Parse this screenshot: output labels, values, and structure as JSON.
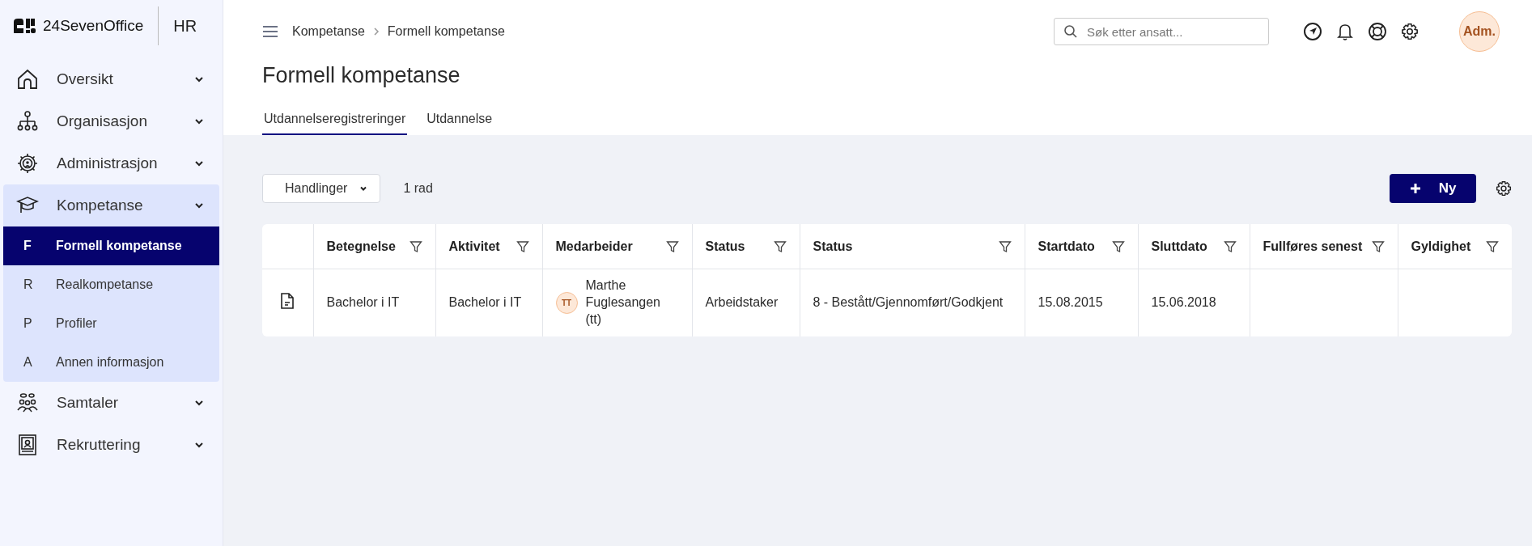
{
  "brand": {
    "name": "24SevenOffice",
    "module": "HR"
  },
  "sidebar": {
    "items": [
      {
        "label": "Oversikt",
        "expanded": false
      },
      {
        "label": "Organisasjon",
        "expanded": false
      },
      {
        "label": "Administrasjon",
        "expanded": false
      },
      {
        "label": "Kompetanse",
        "expanded": true,
        "children": [
          {
            "letter": "F",
            "label": "Formell kompetanse",
            "selected": true
          },
          {
            "letter": "R",
            "label": "Realkompetanse",
            "selected": false
          },
          {
            "letter": "P",
            "label": "Profiler",
            "selected": false
          },
          {
            "letter": "A",
            "label": "Annen informasjon",
            "selected": false
          }
        ]
      },
      {
        "label": "Samtaler",
        "expanded": false
      },
      {
        "label": "Rekruttering",
        "expanded": false
      }
    ]
  },
  "breadcrumb": [
    "Kompetanse",
    "Formell kompetanse"
  ],
  "search": {
    "placeholder": "Søk etter ansatt..."
  },
  "user": {
    "initials": "Adm."
  },
  "page_title": "Formell kompetanse",
  "tabs": [
    {
      "label": "Utdannelseregistreringer",
      "selected": true
    },
    {
      "label": "Utdannelse",
      "selected": false
    }
  ],
  "toolbar": {
    "actions": "Handlinger",
    "row_count": "1 rad",
    "new_button": "Ny"
  },
  "table": {
    "columns": [
      "Betegnelse",
      "Aktivitet",
      "Medarbeider",
      "Status",
      "Status",
      "Startdato",
      "Sluttdato",
      "Fullføres senest",
      "Gyldighet"
    ],
    "rows": [
      {
        "cells": [
          {
            "kind": "text",
            "text": "Bachelor i IT"
          },
          {
            "kind": "text",
            "text": "Bachelor i IT"
          },
          {
            "kind": "person",
            "initials": "TT",
            "text": "Marthe Fuglesangen (tt)"
          },
          {
            "kind": "text",
            "text": "Arbeidstaker"
          },
          {
            "kind": "text",
            "text": "8 - Bestått/Gjennomført/Godkjent"
          },
          {
            "kind": "text",
            "text": "15.08.2015"
          },
          {
            "kind": "text",
            "text": "15.06.2018"
          }
        ]
      }
    ]
  }
}
